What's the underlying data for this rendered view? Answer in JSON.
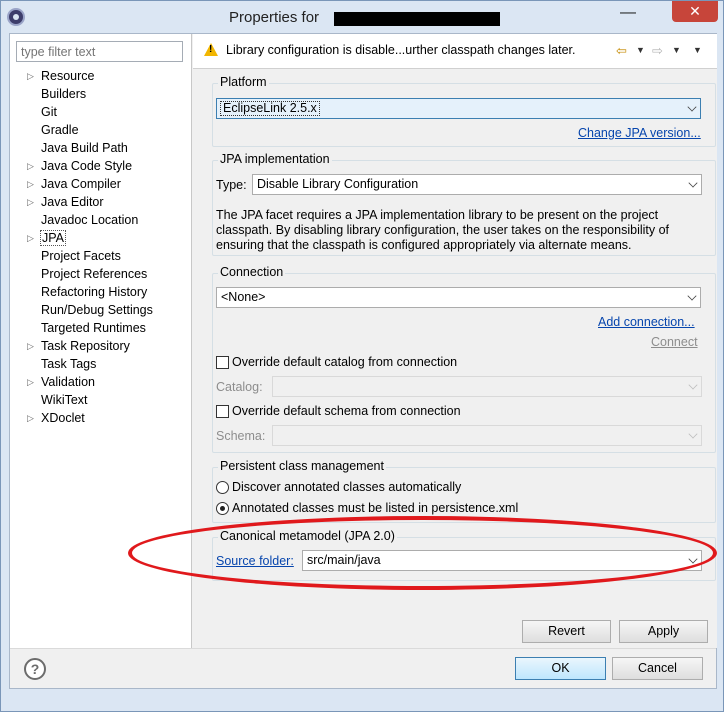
{
  "window": {
    "title": "Properties for",
    "minimize_glyph": "—",
    "close_glyph": "✕"
  },
  "sidebar": {
    "filter_placeholder": "type filter text",
    "items": [
      {
        "label": "Resource",
        "expandable": true
      },
      {
        "label": "Builders",
        "expandable": false
      },
      {
        "label": "Git",
        "expandable": false
      },
      {
        "label": "Gradle",
        "expandable": false
      },
      {
        "label": "Java Build Path",
        "expandable": false
      },
      {
        "label": "Java Code Style",
        "expandable": true
      },
      {
        "label": "Java Compiler",
        "expandable": true
      },
      {
        "label": "Java Editor",
        "expandable": true
      },
      {
        "label": "Javadoc Location",
        "expandable": false
      },
      {
        "label": "JPA",
        "expandable": true,
        "selected": true
      },
      {
        "label": "Project Facets",
        "expandable": false
      },
      {
        "label": "Project References",
        "expandable": false
      },
      {
        "label": "Refactoring History",
        "expandable": false
      },
      {
        "label": "Run/Debug Settings",
        "expandable": false
      },
      {
        "label": "Targeted Runtimes",
        "expandable": false
      },
      {
        "label": "Task Repository",
        "expandable": true
      },
      {
        "label": "Task Tags",
        "expandable": false
      },
      {
        "label": "Validation",
        "expandable": true
      },
      {
        "label": "WikiText",
        "expandable": false
      },
      {
        "label": "XDoclet",
        "expandable": true
      }
    ]
  },
  "header": {
    "message": "Library configuration is disable...urther classpath changes later."
  },
  "platform": {
    "legend": "Platform",
    "value": "EclipseLink 2.5.x",
    "change_link": "Change JPA version..."
  },
  "jpa_impl": {
    "legend": "JPA implementation",
    "type_label": "Type:",
    "type_value": "Disable Library Configuration",
    "description": "The JPA facet requires a JPA implementation library to be present on the project classpath. By disabling library configuration, the user takes on the responsibility of ensuring that the classpath is configured appropriately via alternate means."
  },
  "connection": {
    "legend": "Connection",
    "value": "<None>",
    "add_link": "Add connection...",
    "connect_link": "Connect",
    "override_catalog": "Override default catalog from connection",
    "catalog_label": "Catalog:",
    "override_schema": "Override default schema from connection",
    "schema_label": "Schema:"
  },
  "persistent": {
    "legend": "Persistent class management",
    "option1": "Discover annotated classes automatically",
    "option2": "Annotated classes must be listed in persistence.xml"
  },
  "canonical": {
    "legend": "Canonical metamodel (JPA 2.0)",
    "source_folder_link": "Source folder:",
    "source_folder_value": "src/main/java"
  },
  "buttons": {
    "revert": "Revert",
    "apply": "Apply",
    "ok": "OK",
    "cancel": "Cancel",
    "help": "?"
  },
  "colors": {
    "highlight_ellipse": "#e0191c",
    "link": "#0645ad"
  }
}
